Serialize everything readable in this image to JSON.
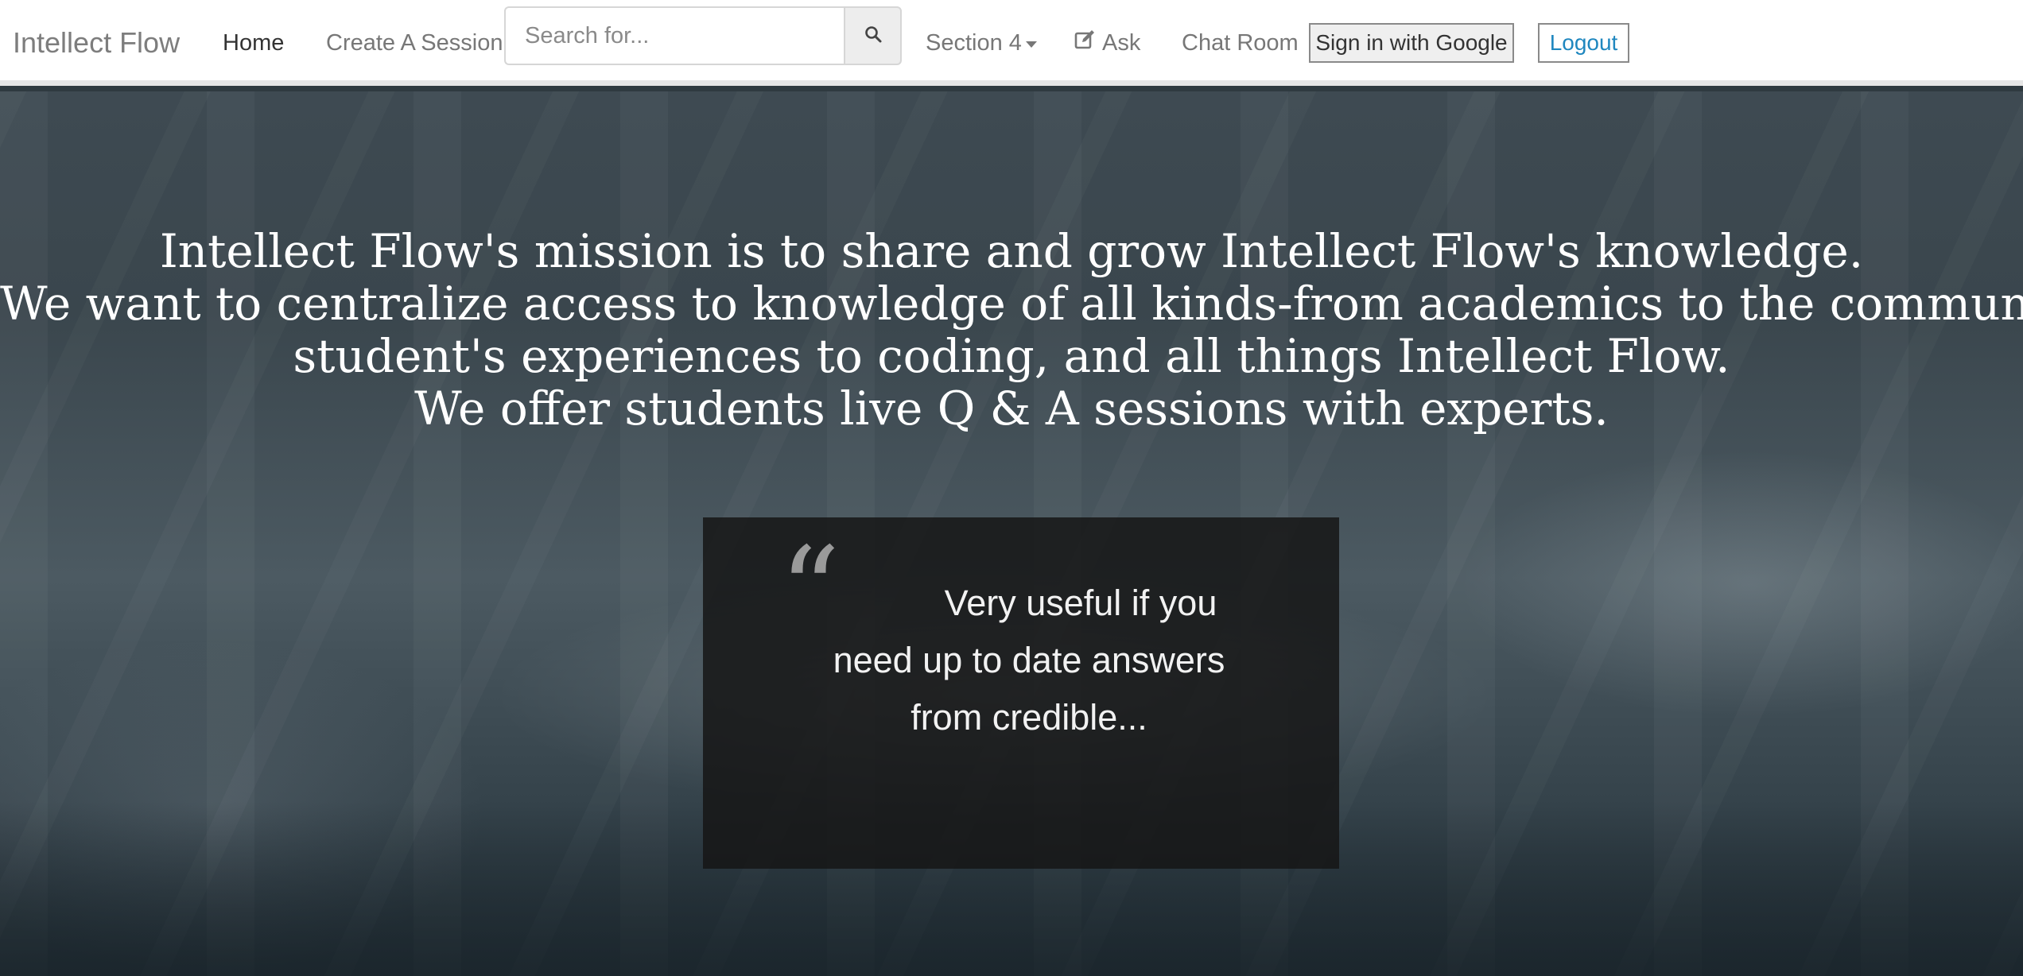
{
  "navbar": {
    "brand": "Intellect Flow",
    "home_label": "Home",
    "create_session_label": "Create A Session",
    "search": {
      "placeholder": "Search for...",
      "value": ""
    },
    "section_label": "Section 4",
    "ask_label": "Ask",
    "chat_room_label": "Chat Room",
    "sign_in_label": "Sign in with Google",
    "logout_label": "Logout",
    "icons": {
      "search": "search-icon",
      "section_caret": "caret-down-icon",
      "ask": "edit-icon"
    }
  },
  "hero": {
    "mission_lines": [
      "Intellect Flow's mission is to share and grow Intellect Flow's knowledge.",
      "We want to centralize access to knowledge of all kinds-from academics to the community,",
      "student's experiences to coding, and all things Intellect Flow.",
      "We offer students live Q & A sessions with experts."
    ],
    "testimonial": {
      "quote_mark": "“",
      "text": "Very useful if you need up to date answers from credible..."
    }
  },
  "colors": {
    "link_accent": "#1f87bf",
    "navbar_bg": "#ffffff",
    "quote_box_bg": "#161616"
  }
}
